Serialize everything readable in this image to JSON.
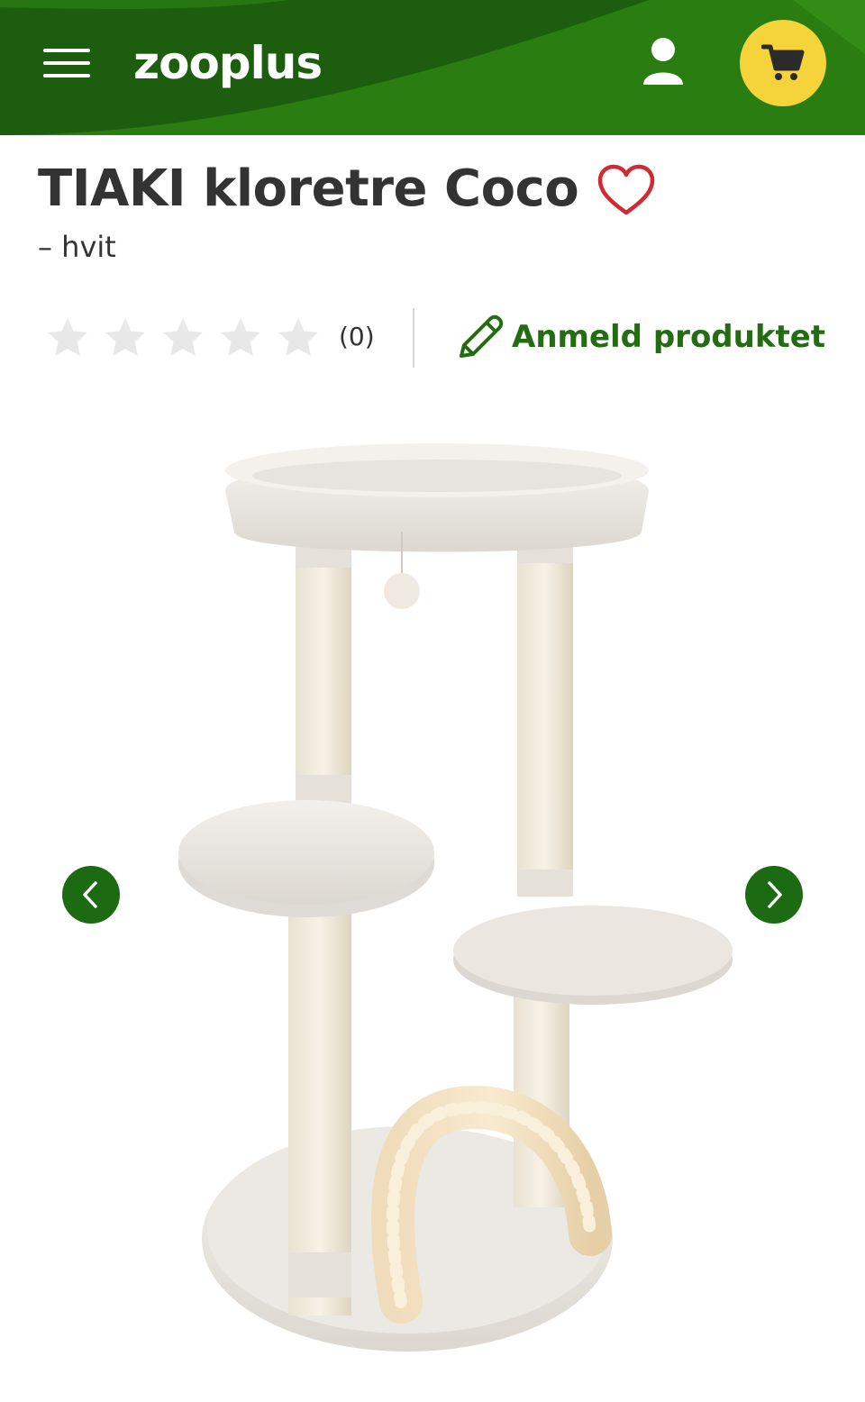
{
  "header": {
    "brand": "zooplus",
    "colors": {
      "bar": "#1c5e0e",
      "bar_highlight": "#2e8a12",
      "cart_badge": "#f5d33a"
    },
    "icons": [
      "menu-icon",
      "user-icon",
      "cart-icon"
    ]
  },
  "product": {
    "title": "TIAKI kloretre Coco",
    "variant": "– hvit",
    "favorite_icon": "heart-icon"
  },
  "rating": {
    "stars_filled": 0,
    "stars_total": 5,
    "count_label": "(0)",
    "review_link_label": "Anmeld produktet",
    "review_icon": "pencil-icon",
    "accent_color": "#236c12"
  },
  "gallery": {
    "image_subject": "cat-tree",
    "prev_icon": "chevron-left-icon",
    "next_icon": "chevron-right-icon"
  }
}
